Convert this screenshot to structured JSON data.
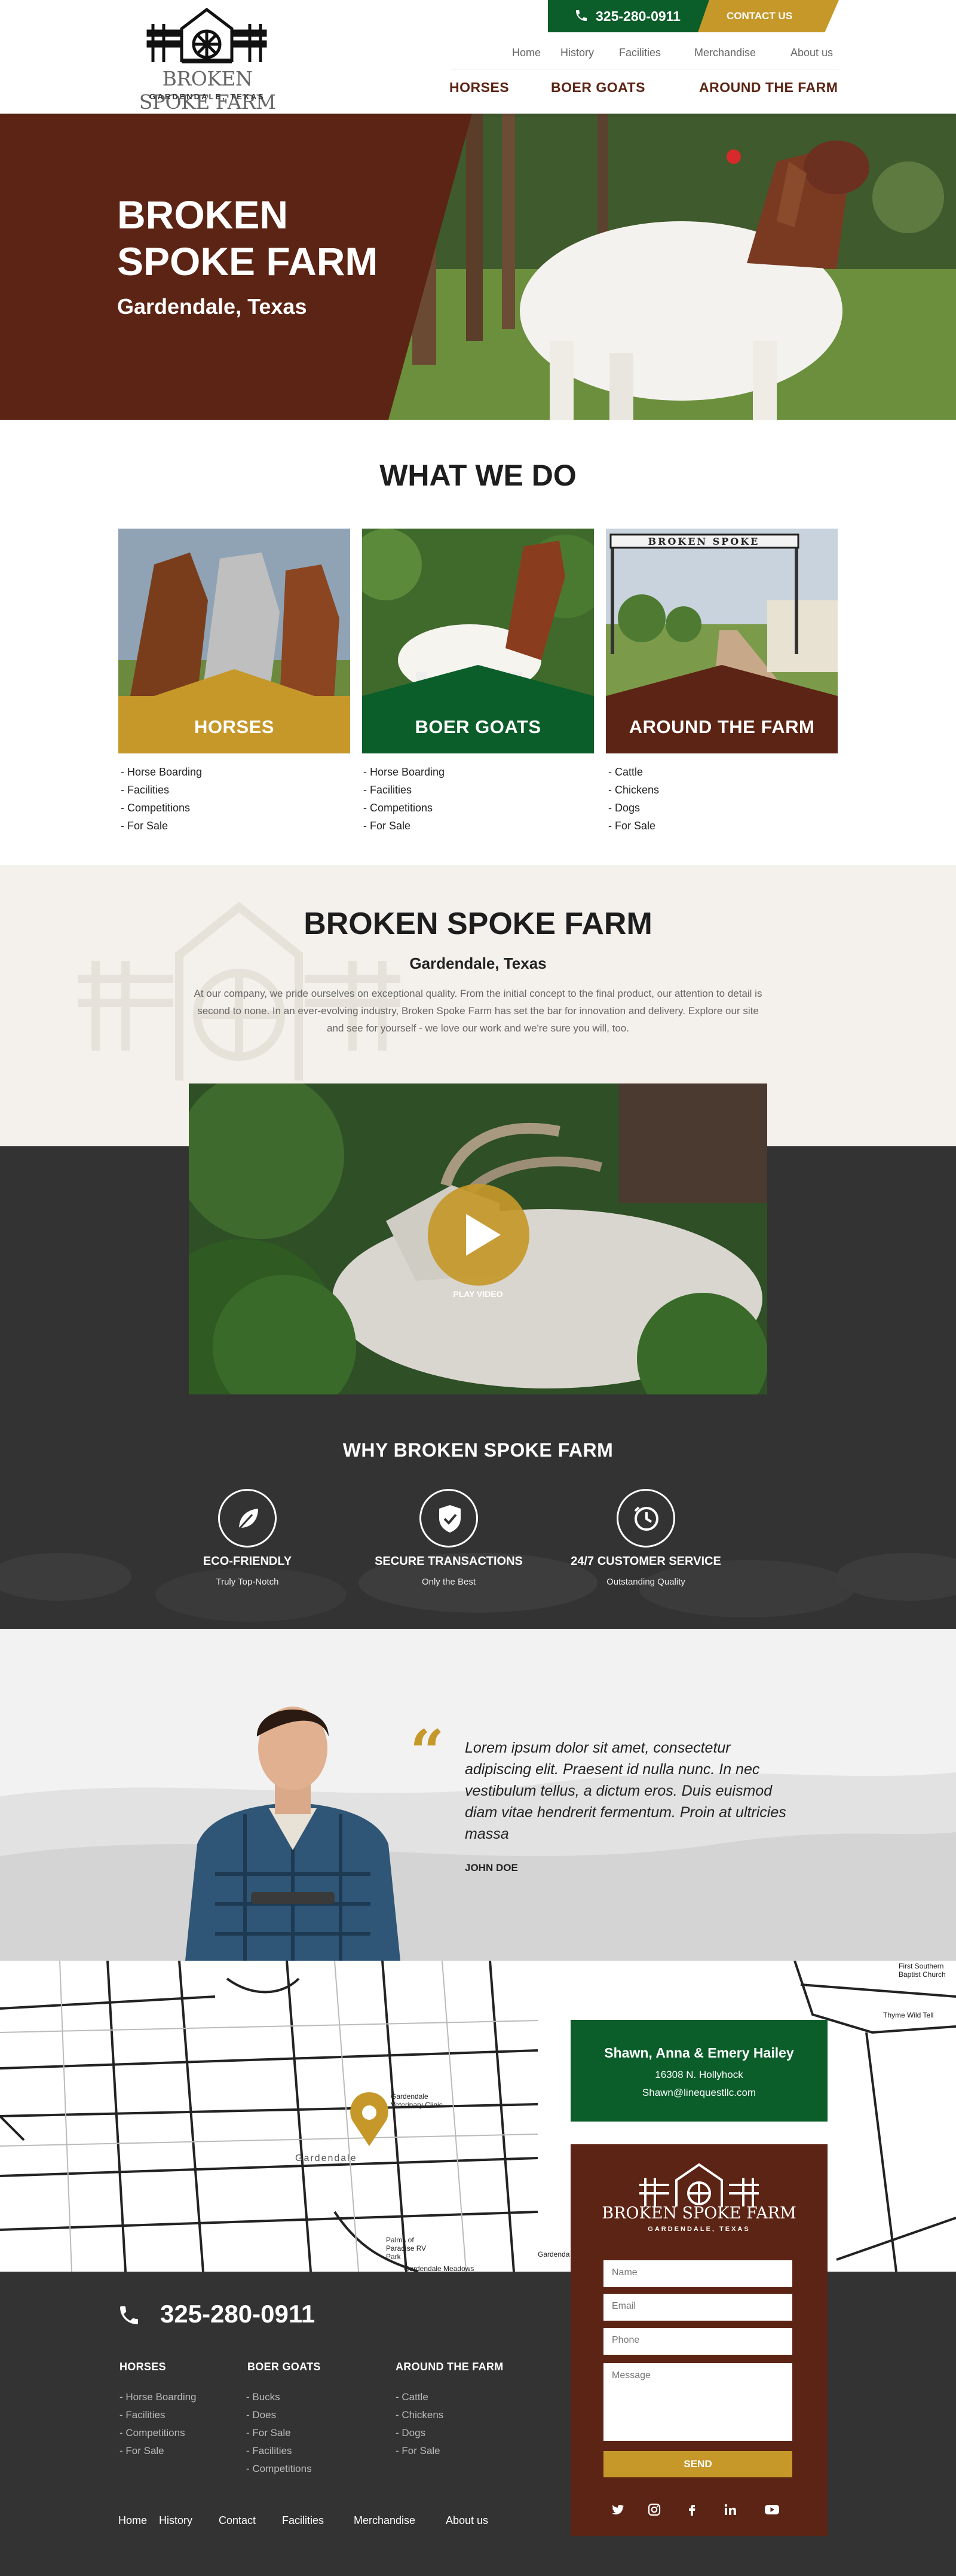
{
  "header": {
    "phone": "325-280-0911",
    "contact_label": "CONTACT US",
    "logo_name": "BROKEN SPOKE FARM",
    "logo_place": "GARDENDALE, TEXAS",
    "top_nav": [
      "Home",
      "History",
      "Facilities",
      "Merchandise",
      "About us"
    ],
    "main_nav": [
      "HORSES",
      "BOER GOATS",
      "AROUND THE FARM"
    ]
  },
  "hero": {
    "title_line1": "BROKEN",
    "title_line2": "SPOKE FARM",
    "subtitle": "Gardendale, Texas"
  },
  "what_we_do": {
    "title": "WHAT WE DO",
    "cards": [
      {
        "label": "HORSES",
        "color": "#c6982a",
        "items": [
          "- Horse Boarding",
          "- Facilities",
          "- Competitions",
          "- For Sale"
        ]
      },
      {
        "label": "BOER GOATS",
        "color": "#0b5d2a",
        "items": [
          "- Horse Boarding",
          "- Facilities",
          "- Competitions",
          "- For Sale"
        ]
      },
      {
        "label": "AROUND THE FARM",
        "color": "#5c2414",
        "items": [
          "- Cattle",
          "- Chickens",
          "- Dogs",
          "- For Sale"
        ]
      }
    ],
    "gate_sign": "BROKEN SPOKE"
  },
  "about": {
    "title": "BROKEN SPOKE FARM",
    "subtitle": "Gardendale, Texas",
    "text": "At our company, we pride ourselves on exceptional quality. From the initial concept to the final product, our attention to detail is second to none. In an ever-evolving industry, Broken Spoke Farm has set the bar for innovation and delivery. Explore our site and see for yourself - we love our work and we're sure you will, too."
  },
  "video": {
    "play_label": "PLAY VIDEO"
  },
  "why": {
    "title": "WHY BROKEN SPOKE FARM",
    "features": [
      {
        "icon": "leaf-icon",
        "title": "ECO-FRIENDLY",
        "sub": "Truly Top-Notch"
      },
      {
        "icon": "shield-check-icon",
        "title": "SECURE TRANSACTIONS",
        "sub": "Only the Best"
      },
      {
        "icon": "clock-icon",
        "title": "24/7 CUSTOMER SERVICE",
        "sub": "Outstanding Quality"
      }
    ]
  },
  "testimonial": {
    "quote": "Lorem ipsum dolor sit amet, consectetur adipiscing elit. Praesent id nulla nunc. In nec vestibulum tellus, a dictum eros. Duis euismod diam vitae hendrerit fermentum. Proin at ultricies massa",
    "author": "JOHN DOE"
  },
  "map": {
    "labels": {
      "church": "First Southern Baptist Church",
      "thyme": "Thyme Wild Tell",
      "vet": "Gardendale Veterinary Clinic",
      "town": "Gardendale",
      "palms": "Palms of Paradise RV Park",
      "meadows": "Gardendale Meadows",
      "gardenda": "Gardenda"
    }
  },
  "contact": {
    "names": "Shawn, Anna & Emery Hailey",
    "address": "16308 N. Hollyhock",
    "email": "Shawn@linequestllc.com",
    "fields": {
      "name": "Name",
      "email": "Email",
      "phone": "Phone",
      "message": "Message"
    },
    "send": "SEND"
  },
  "footer": {
    "phone": "325-280-0911",
    "columns": [
      {
        "title": "HORSES",
        "items": [
          "- Horse Boarding",
          "- Facilities",
          "- Competitions",
          "- For Sale"
        ]
      },
      {
        "title": "BOER GOATS",
        "items": [
          "- Bucks",
          "- Does",
          "- For Sale",
          "- Facilities",
          "- Competitions"
        ]
      },
      {
        "title": "AROUND THE FARM",
        "items": [
          "- Cattle",
          "- Chickens",
          "- Dogs",
          "- For Sale"
        ]
      }
    ],
    "nav": [
      "Home",
      "History",
      "Contact",
      "Facilities",
      "Merchandise",
      "About us"
    ]
  },
  "colors": {
    "maroon": "#5c2414",
    "green": "#0b5d2a",
    "gold": "#c6982a",
    "dark": "#333333"
  }
}
